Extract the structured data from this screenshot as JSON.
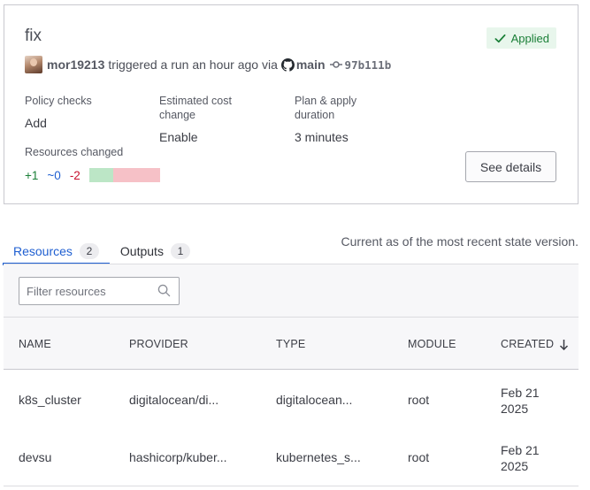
{
  "run": {
    "title": "fix",
    "status": "Applied",
    "user": "mor19213",
    "action_text": "triggered a run an hour ago via",
    "branch": "main",
    "commit": "97b111b",
    "policy_checks_label": "Policy checks",
    "policy_checks_value": "Add",
    "cost_label": "Estimated cost change",
    "cost_value": "Enable",
    "duration_label": "Plan & apply duration",
    "duration_value": "3 minutes",
    "resources_changed_label": "Resources changed",
    "resources_added": "+1",
    "resources_changed": "~0",
    "resources_destroyed": "-2",
    "details_button": "See details",
    "colors": {
      "success": "#1a7f37",
      "change": "#1f5fd1",
      "destroy": "#c8102e"
    }
  },
  "tabs": [
    {
      "label": "Resources",
      "count": "2"
    },
    {
      "label": "Outputs",
      "count": "1"
    }
  ],
  "state_note": "Current as of the most recent state version.",
  "filter": {
    "placeholder": "Filter resources"
  },
  "table": {
    "headers": [
      "NAME",
      "PROVIDER",
      "TYPE",
      "MODULE",
      "CREATED"
    ],
    "rows": [
      {
        "name": "k8s_cluster",
        "provider": "digitalocean/di...",
        "type": "digitalocean...",
        "module": "root",
        "created": "Feb 21 2025"
      },
      {
        "name": "devsu",
        "provider": "hashicorp/kuber...",
        "type": "kubernetes_s...",
        "module": "root",
        "created": "Feb 21 2025"
      }
    ]
  }
}
